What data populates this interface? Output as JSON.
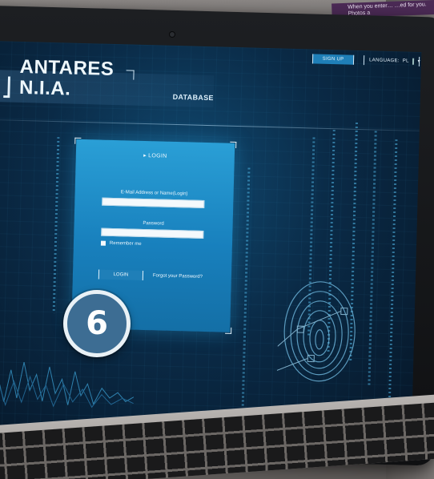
{
  "magazine_text": "When you enter… …ed for you. Photos a",
  "header": {
    "signup_label": "SIGN UP",
    "language_label": "LANGUAGE:",
    "language_code": "PL"
  },
  "brand": {
    "name": "ANTARES N.I.A.",
    "subtitle": "DATABASE"
  },
  "login": {
    "title": "▸ LOGIN",
    "email_label": "E-Mail Address or Name(Login)",
    "email_value": "",
    "password_label": "Password",
    "password_value": "",
    "remember_label": "Remember me",
    "login_button": "LOGIN",
    "forgot_link": "Forgot your Password?"
  },
  "step_badge": "6",
  "colors": {
    "panel": "#1f8cc7",
    "screen_bg": "#0a2a46",
    "badge": "#3d6d93"
  }
}
